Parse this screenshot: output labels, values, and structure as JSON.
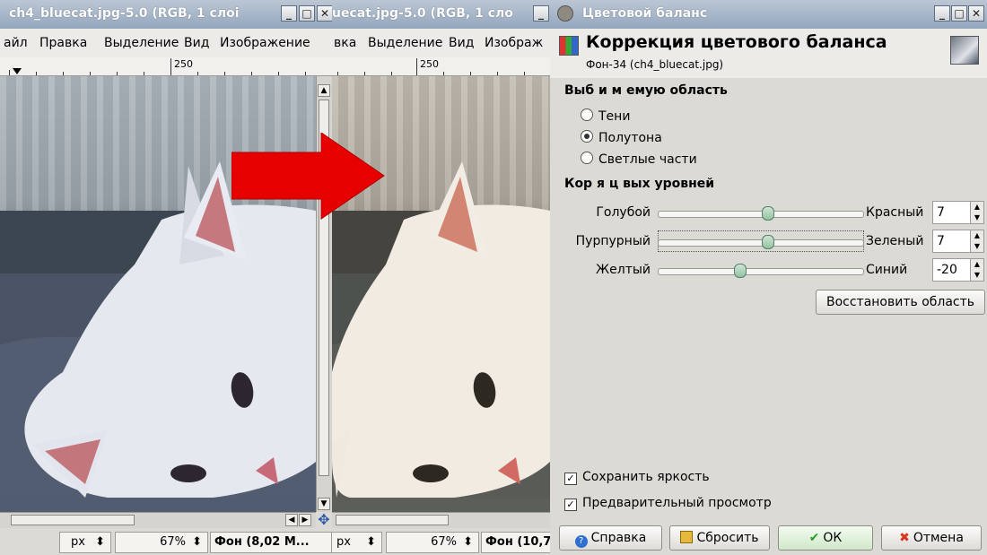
{
  "left_window": {
    "title": "ch4_bluecat.jpg-5.0 (RGB, 1 слоі",
    "menu": [
      "айл",
      "Правка",
      "Выделение",
      "Вид",
      "Изображение"
    ],
    "ruler_label": "250",
    "unit": "px",
    "zoom": "67%",
    "layer_status": "Фон (8,02 М..."
  },
  "right_window": {
    "title": "uecat.jpg-5.0 (RGB, 1 сло",
    "menu": [
      "вка",
      "Выделение",
      "Вид",
      "Изображ"
    ],
    "ruler_label": "250",
    "unit": "px",
    "zoom": "67%",
    "layer_status": "Фон (10,7"
  },
  "arrow_color": "#e60000",
  "dialog": {
    "title": "Цветовой баланс",
    "header_title": "Коррекция цветового баланса",
    "header_subtitle": "Фон-34 (ch4_bluecat.jpg)",
    "range_section": "Выб    и м    емую область",
    "ranges": [
      {
        "label": "Тени",
        "selected": false
      },
      {
        "label": "Полутона",
        "selected": true
      },
      {
        "label": "Светлые части",
        "selected": false
      }
    ],
    "levels_section": "Кор       я  ц    вых уровней",
    "sliders": [
      {
        "left": "Голубой",
        "right": "Красный",
        "value": "7",
        "level": 7
      },
      {
        "left": "Пурпурный",
        "right": "Зеленый",
        "value": "7",
        "level": 7
      },
      {
        "left": "Желтый",
        "right": "Синий",
        "value": "-20",
        "level": -20
      }
    ],
    "reset_range_button": "Восстановить область",
    "preserve_luminosity": "Сохранить яркость",
    "preview": "Предварительный просмотр",
    "buttons": {
      "help": "Справка",
      "reset": "Сбросить",
      "ok": "ОК",
      "cancel": "Отмена"
    }
  }
}
